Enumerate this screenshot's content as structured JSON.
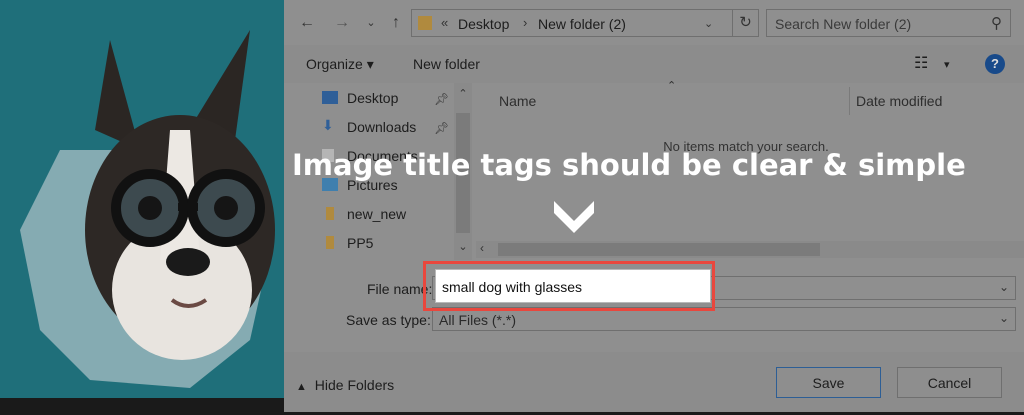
{
  "address_bar": {
    "crumbs": [
      "Desktop",
      "New folder (2)"
    ],
    "overflow": "«"
  },
  "search": {
    "placeholder": "Search New folder (2)"
  },
  "toolbar": {
    "organize": "Organize ▾",
    "new_folder": "New folder",
    "view_caret": "▾",
    "help": "?"
  },
  "nav_pane": {
    "items": [
      {
        "label": "Desktop",
        "icon": "desktop-icon",
        "pinned": true
      },
      {
        "label": "Downloads",
        "icon": "download-icon",
        "pinned": true
      },
      {
        "label": "Documents",
        "icon": "documents-icon",
        "pinned": true
      },
      {
        "label": "Pictures",
        "icon": "pictures-icon",
        "pinned": false
      },
      {
        "label": "new_new",
        "icon": "folder-icon",
        "pinned": false
      },
      {
        "label": "PP5",
        "icon": "folder-icon",
        "pinned": false
      }
    ]
  },
  "content": {
    "columns": [
      "Name",
      "Date modified"
    ],
    "empty_message": "No items match your search."
  },
  "form": {
    "file_name_label": "File name:",
    "file_name_value": "small dog with glasses",
    "save_as_type_label": "Save as type:",
    "save_as_type_value": "All Files (*.*)"
  },
  "footer": {
    "hide_folders": "Hide Folders",
    "save": "Save",
    "cancel": "Cancel"
  },
  "overlay": {
    "caption": "Image title tags should be clear & simple"
  },
  "colors": {
    "highlight": "#e9473d",
    "dialog_dimmed": "#8f8f8f",
    "photo_bg": "#1f6f7a"
  }
}
